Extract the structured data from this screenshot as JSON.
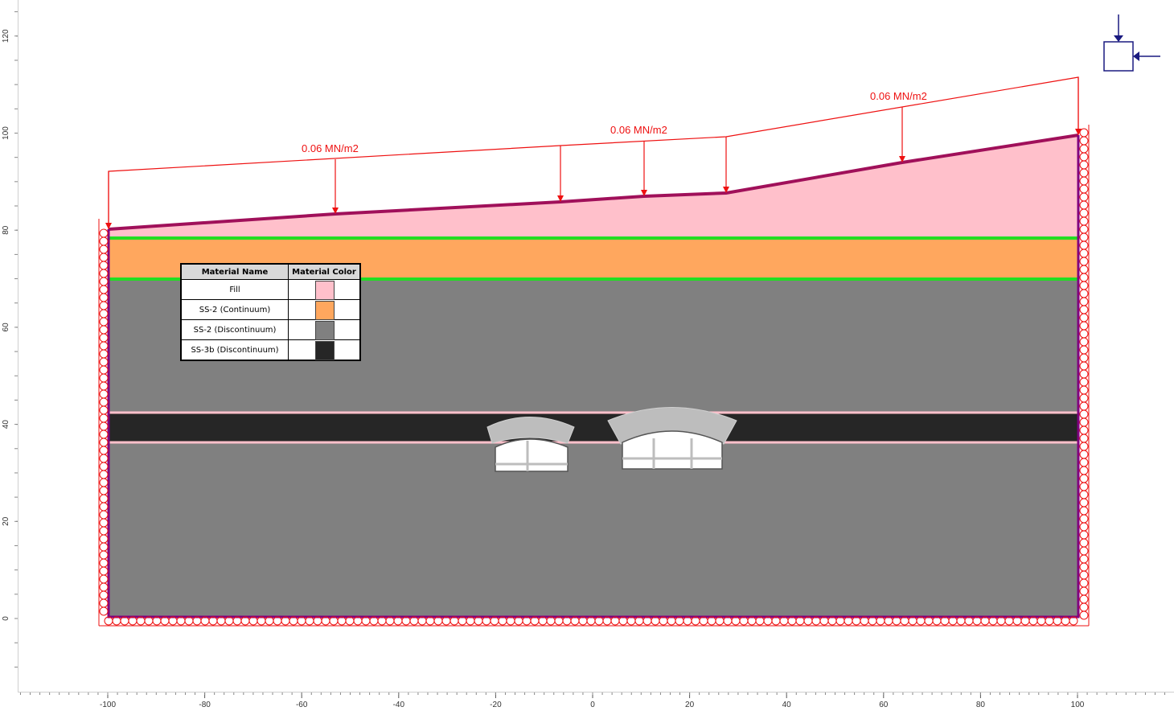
{
  "axes": {
    "y_ticks": [
      "120",
      "100",
      "80",
      "60",
      "40",
      "20",
      "0"
    ],
    "x_ticks": [
      "-100",
      "-80",
      "-60",
      "-40",
      "-20",
      "0",
      "20",
      "40",
      "60",
      "80",
      "100"
    ]
  },
  "loads": {
    "labels": [
      "0.06 MN/m2",
      "0.06 MN/m2",
      "0.06 MN/m2"
    ]
  },
  "legend": {
    "header_name": "Material Name",
    "header_color": "Material Color",
    "rows": [
      {
        "name": "Fill",
        "color": "#ffc0cb"
      },
      {
        "name": "SS-2 (Continuum)",
        "color": "#ffa75e"
      },
      {
        "name": "SS-2 (Discontinuum)",
        "color": "#808080"
      },
      {
        "name": "SS-3b (Discontinuum)",
        "color": "#262626"
      }
    ]
  },
  "colors": {
    "fill": "#ffc0cb",
    "continuum": "#ffa75e",
    "discontinuum": "#808080",
    "ss3b": "#262626",
    "boundary": "#800080",
    "load": "#ee1111",
    "interface": "#22dd22"
  }
}
